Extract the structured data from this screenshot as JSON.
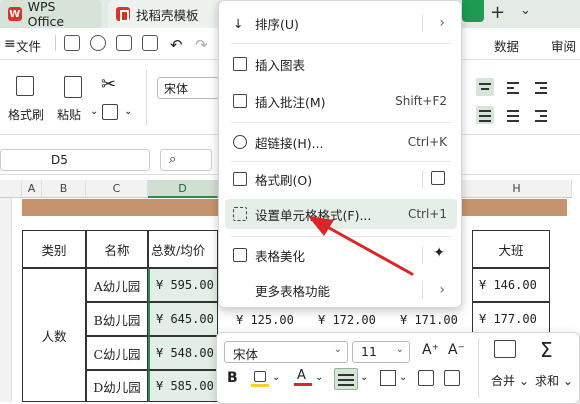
{
  "tabs": [
    {
      "label": "WPS Office"
    },
    {
      "label": "找稻壳模板"
    }
  ],
  "menubar": {
    "file": "文件",
    "data": "数据",
    "review": "审阅"
  },
  "ribbon": {
    "format_painter": "格式刷",
    "paste": "粘贴",
    "font_name": "宋体"
  },
  "formula_bar": {
    "cell_ref": "D5"
  },
  "columns": [
    "A",
    "B",
    "C",
    "D",
    "H"
  ],
  "table": {
    "headers": [
      "类别",
      "名称",
      "总数/均价",
      "大班"
    ],
    "group_label": "人数",
    "rows": [
      {
        "name": "A幼儿园",
        "total": "¥ 595.00",
        "big": "¥ 146.00"
      },
      {
        "name": "B幼儿园",
        "total": "¥ 645.00",
        "e": "¥ 125.00",
        "f": "¥ 172.00",
        "g": "¥ 171.00",
        "big": "¥ 177.00"
      },
      {
        "name": "C幼儿园",
        "total": "¥ 548.00"
      },
      {
        "name": "D幼儿园",
        "total": "¥ 585.00"
      }
    ]
  },
  "context_menu": {
    "items": [
      {
        "label": "排序(U)",
        "shortcut": "",
        "arrow": true
      },
      {
        "label": "插入图表",
        "shortcut": ""
      },
      {
        "label": "插入批注(M)",
        "shortcut": "Shift+F2"
      },
      {
        "label": "超链接(H)...",
        "shortcut": "Ctrl+K"
      },
      {
        "label": "格式刷(O)",
        "shortcut": ""
      },
      {
        "label": "设置单元格格式(F)...",
        "shortcut": "Ctrl+1",
        "highlighted": true
      },
      {
        "label": "表格美化",
        "shortcut": ""
      },
      {
        "label": "更多表格功能",
        "shortcut": "",
        "arrow": true
      }
    ]
  },
  "mini_toolbar": {
    "font": "宋体",
    "size": "11",
    "bold": "B",
    "merge": "合并",
    "sum": "求和"
  },
  "colors": {
    "accent_green": "#1d9b53",
    "arrow_red": "#d8262b",
    "banner": "#c5946e",
    "selection": "#e3efe6"
  }
}
